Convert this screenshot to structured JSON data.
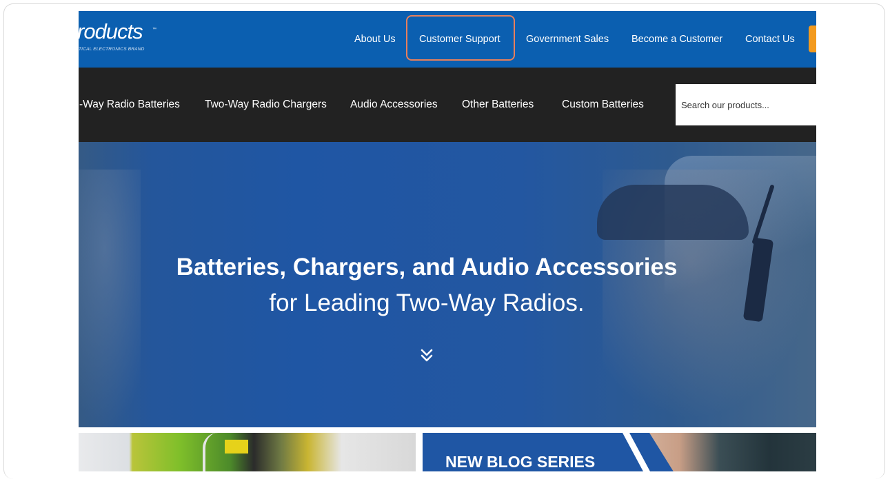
{
  "brand": {
    "logo_text": "roducts",
    "logo_tm": "™",
    "logo_sub": "TICAL ELECTRONICS BRAND"
  },
  "top_nav": {
    "items": [
      "About Us",
      "Customer Support",
      "Government Sales",
      "Become a Customer",
      "Contact Us"
    ],
    "highlighted": "Customer Support",
    "highlight_color": "#e8805c",
    "bar_color": "#0b5fb0",
    "cta_color": "#f39a1e"
  },
  "category_nav": {
    "items": [
      "-Way Radio Batteries",
      "Two-Way Radio Chargers",
      "Audio Accessories",
      "Other Batteries",
      "Custom Batteries"
    ],
    "bar_color": "#222222"
  },
  "search": {
    "placeholder": "Search our products..."
  },
  "hero": {
    "title": "Batteries, Chargers, and Audio Accessories",
    "subtitle": "for Leading Two-Way Radios.",
    "scroll_icon": "double-chevron-down-icon",
    "bg_color": "#1f56a4"
  },
  "promo": {
    "blog_title": "NEW BLOG SERIES"
  }
}
